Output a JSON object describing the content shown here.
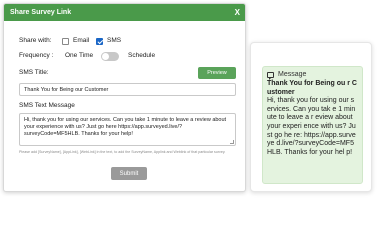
{
  "modal": {
    "title": "Share Survey Link",
    "close_label": "X",
    "share_with_label": "Share with:",
    "option_email": "Email",
    "option_sms": "SMS",
    "frequency_label": "Frequency :",
    "frequency_one_time": "One Time",
    "frequency_schedule": "Schedule",
    "sms_title_label": "SMS Title:",
    "preview_button": "Preview",
    "sms_title_value": "Thank You for Being our Customer",
    "sms_text_label": "SMS Text Message",
    "sms_text_value": "Hi, thank you for using our services. Can you take 1 minute to leave a review about your experience with us? Just go here https://app.surveyed.live/?surveyCode=MF5HLB. Thanks for your help!",
    "hint": "Please add [SurveyName], [AppLink], [WebLink] in the text, to add the SurveyName, Applink and Weblink of that particular survey.",
    "submit_button": "Submit"
  },
  "preview": {
    "header": "Message",
    "title_line": "Thank You for Being ou r Customer",
    "body": "Hi, thank you for using our services. Can you tak e 1 minute to leave a r eview about your experi ence with us? Just go he re: https://app.surveye d.live/?surveyCode=MF5 HLB. Thanks for your hel p!"
  },
  "colors": {
    "header_green": "#4a9a4a",
    "preview_button_green": "#5aa35a",
    "checkbox_blue": "#1a66c6",
    "bubble_green": "#e4f3df",
    "submit_gray": "#9a9a9a"
  }
}
